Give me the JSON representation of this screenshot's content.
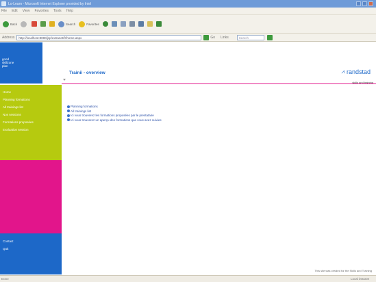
{
  "browser": {
    "title": "Lo-Learn - Microsoft Internet Explorer provided by Intel",
    "menu": [
      "File",
      "Edit",
      "View",
      "Favorites",
      "Tools",
      "Help"
    ],
    "toolbar": {
      "back_label": "Back",
      "search_label": "Search",
      "favorites_label": "Favorites"
    },
    "address_label": "Address",
    "url": "http://localhost:8080/jsp/extranet/fr/home.aspx",
    "go_label": "Go",
    "links_label": "Links",
    "search_placeholder": "Search"
  },
  "sidebar": {
    "logo_lines": [
      "good",
      "skillzone",
      "plan"
    ],
    "green_items": [
      "Home",
      "Planning formations",
      "All trainings list",
      "Nos sessions",
      "Formations proposées",
      "Evaluation session"
    ],
    "blue_items": [
      "Contact",
      "Quit"
    ]
  },
  "header": {
    "title": "Trainii - overview",
    "brand": "randstad",
    "subtitle": "skills and training"
  },
  "links": [
    "Planning formations",
    "All trainings list",
    "Ici vous trouverez les formations proposées par le prestataire",
    "Ici vous trouverez un aperçu des formations que vous avez suivies"
  ],
  "footer": "This site was created for the Skills and Training",
  "status": {
    "left": "Done",
    "zone": "Local intranet"
  },
  "colors": {
    "blue": "#1d68c8",
    "green": "#b6ca0f",
    "pink": "#e2158b"
  }
}
